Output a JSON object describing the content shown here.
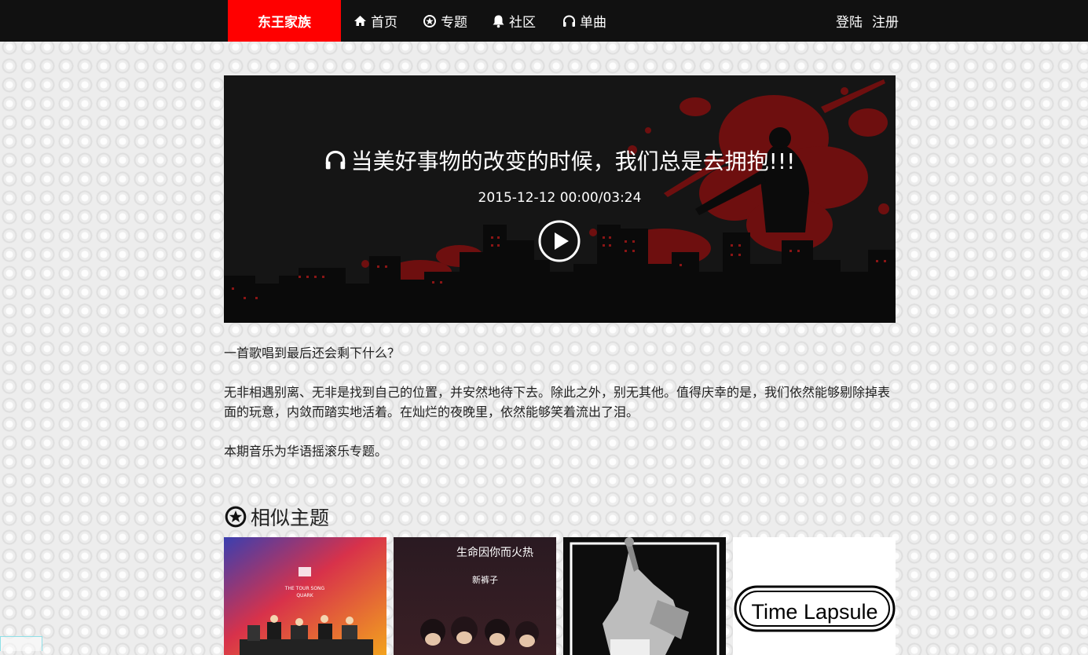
{
  "nav": {
    "brand": "东王家族",
    "items": [
      {
        "label": "首页",
        "icon": "home-icon"
      },
      {
        "label": "专题",
        "icon": "star-circle-icon"
      },
      {
        "label": "社区",
        "icon": "bell-icon"
      },
      {
        "label": "单曲",
        "icon": "headphones-icon"
      }
    ],
    "login": "登陆",
    "register": "注册"
  },
  "banner": {
    "title": "当美好事物的改变的时候，我们总是去拥抱!!!",
    "meta": "2015-12-12 00:00/03:24",
    "icon": "headphones-icon"
  },
  "description": {
    "p1": "一首歌唱到最后还会剩下什么？",
    "p2": "无非相遇别离、无非是找到自己的位置，并安然地待下去。除此之外，别无其他。值得庆幸的是，我们依然能够剔除掉表面的玩意，内敛而踏实地活着。在灿烂的夜晚里，依然能够笑着流出了泪。",
    "p3": "本期音乐为华语摇滚乐专题。"
  },
  "similar": {
    "title": "相似主题",
    "icon": "star-circle-icon",
    "cards": [
      {
        "name": "card-the-tour-song",
        "caption_line1": "THE TOUR SONG",
        "caption_line2": "QUARK"
      },
      {
        "name": "card-xin-ku-zi",
        "caption_line1": "新裤子",
        "caption_line2": "生命因你而火热"
      },
      {
        "name": "card-rock-singer",
        "caption_line1": ""
      },
      {
        "name": "card-time-lapsule",
        "caption_line1": "Time Lapsule"
      }
    ]
  },
  "colors": {
    "brand": "#ff0000",
    "nav_bg": "#111111",
    "splatter": "#7a1010"
  }
}
